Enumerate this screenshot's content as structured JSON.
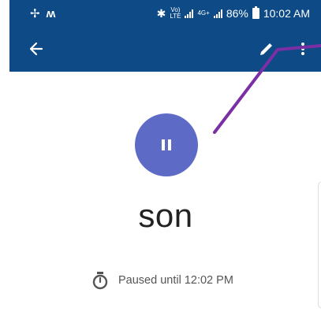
{
  "status_bar": {
    "left_icons": [
      "fan-icon",
      "m-logo-icon"
    ],
    "volte_top": "Vo)",
    "volte_bottom": "LTE",
    "network": "4G+",
    "battery_percent": "86%",
    "time": "10:02 AM",
    "icons": [
      "bluetooth-icon",
      "volte-icon",
      "signal-icon",
      "battery-icon"
    ]
  },
  "app_bar": {
    "icons": [
      "back-arrow-icon",
      "pencil-icon",
      "more-vert-icon"
    ]
  },
  "profile": {
    "name": "son",
    "pause_icon": "pause-icon"
  },
  "status": {
    "icon": "timer-icon",
    "text": "Paused until 12:02 PM"
  },
  "colors": {
    "app_bar": "#0d4a86",
    "pause_button": "#5e6bc6",
    "annotation_line": "#7b2fa5"
  }
}
